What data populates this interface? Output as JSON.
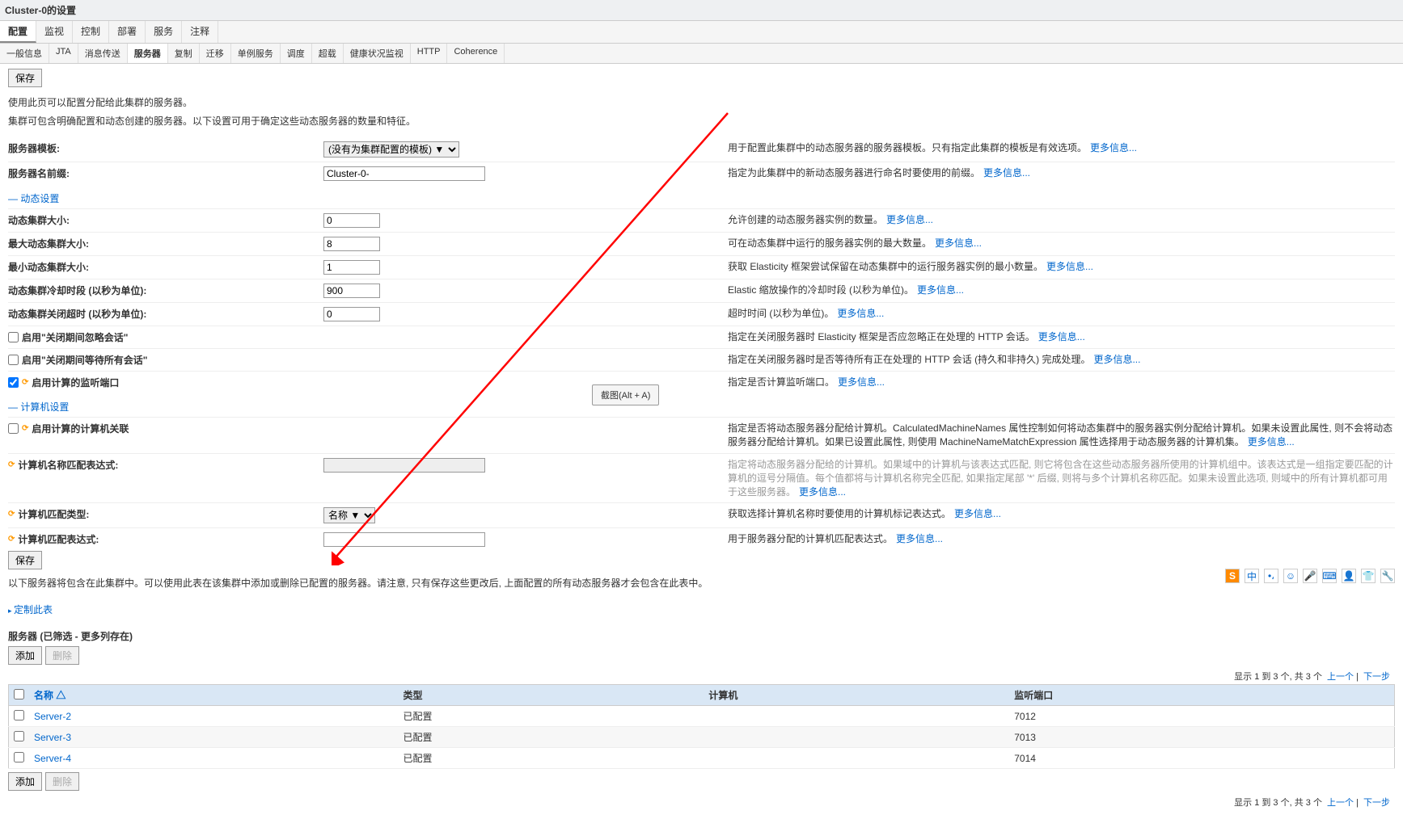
{
  "page_title": "Cluster-0的设置",
  "main_tabs": [
    "配置",
    "监视",
    "控制",
    "部署",
    "服务",
    "注释"
  ],
  "main_tab_active": 0,
  "sub_tabs": [
    "一般信息",
    "JTA",
    "消息传送",
    "服务器",
    "复制",
    "迁移",
    "单例服务",
    "调度",
    "超载",
    "健康状况监视",
    "HTTP",
    "Coherence"
  ],
  "sub_tab_active": 3,
  "save_button": "保存",
  "intro_lines": [
    "使用此页可以配置分配给此集群的服务器。",
    "集群可包含明确配置和动态创建的服务器。以下设置可用于确定这些动态服务器的数量和特征。"
  ],
  "form": {
    "server_template": {
      "label": "服务器模板:",
      "value": "(没有为集群配置的模板) ▼",
      "desc": "用于配置此集群中的动态服务器的服务器模板。只有指定此集群的模板是有效选项。",
      "more": "更多信息..."
    },
    "server_prefix": {
      "label": "服务器名前缀:",
      "value": "Cluster-0-",
      "desc": "指定为此集群中的新动态服务器进行命名时要使用的前缀。",
      "more": "更多信息..."
    }
  },
  "dyn_legend": "动态设置",
  "dyn": {
    "size": {
      "label": "动态集群大小:",
      "value": "0",
      "desc": "允许创建的动态服务器实例的数量。",
      "more": "更多信息..."
    },
    "max": {
      "label": "最大动态集群大小:",
      "value": "8",
      "desc": "可在动态集群中运行的服务器实例的最大数量。",
      "more": "更多信息..."
    },
    "min": {
      "label": "最小动态集群大小:",
      "value": "1",
      "desc": "获取 Elasticity 框架尝试保留在动态集群中的运行服务器实例的最小数量。",
      "more": "更多信息..."
    },
    "cooldown": {
      "label": "动态集群冷却时段 (以秒为单位):",
      "value": "900",
      "desc": "Elastic 缩放操作的冷却时段 (以秒为单位)。",
      "more": "更多信息..."
    },
    "timeout": {
      "label": "动态集群关闭超时 (以秒为单位):",
      "value": "0",
      "desc": "超时时间 (以秒为单位)。",
      "more": "更多信息..."
    },
    "ignore": {
      "label": "启用\"关闭期间忽略会话\"",
      "desc": "指定在关闭服务器时 Elasticity 框架是否应忽略正在处理的 HTTP 会话。",
      "more": "更多信息..."
    },
    "wait_all": {
      "label": "启用\"关闭期间等待所有会话\"",
      "desc": "指定在关闭服务器时是否等待所有正在处理的 HTTP 会话 (持久和非持久) 完成处理。",
      "more": "更多信息..."
    },
    "listen_port": {
      "label": "启用计算的监听端口",
      "desc": "指定是否计算监听端口。",
      "more": "更多信息..."
    }
  },
  "comp_legend": "计算机设置",
  "comp": {
    "assoc": {
      "label": "启用计算的计算机关联",
      "desc": "指定是否将动态服务器分配给计算机。CalculatedMachineNames 属性控制如何将动态集群中的服务器实例分配给计算机。如果未设置此属性, 则不会将动态服务器分配给计算机。如果已设置此属性, 则使用 MachineNameMatchExpression 属性选择用于动态服务器的计算机集。",
      "more": "更多信息..."
    },
    "name_expr": {
      "label": "计算机名称匹配表达式:",
      "desc": "指定将动态服务器分配给的计算机。如果域中的计算机与该表达式匹配, 则它将包含在这些动态服务器所使用的计算机组中。该表达式是一组指定要匹配的计算机的逗号分隔值。每个值都将与计算机名称完全匹配, 如果指定尾部 '*' 后缀, 则将与多个计算机名称匹配。如果未设置此选项, 则域中的所有计算机都可用于这些服务器。",
      "more": "更多信息..."
    },
    "match_type": {
      "label": "计算机匹配类型:",
      "value": "名称 ▼",
      "desc": "获取选择计算机名称时要使用的计算机标记表达式。",
      "more": "更多信息..."
    },
    "match_expr": {
      "label": "计算机匹配表达式:",
      "desc": "用于服务器分配的计算机匹配表达式。",
      "more": "更多信息..."
    }
  },
  "note": "以下服务器将包含在此集群中。可以使用此表在该集群中添加或删除已配置的服务器。请注意, 只有保存这些更改后, 上面配置的所有动态服务器才会包含在此表中。",
  "customize_link": "定制此表",
  "table_title": "服务器 (已筛选 - 更多列存在)",
  "add_btn": "添加",
  "del_btn": "删除",
  "pager": {
    "text": "显示 1 到 3 个, 共 3 个",
    "prev": "上一个",
    "next": "下一步"
  },
  "columns": [
    "名称",
    "类型",
    "计算机",
    "监听端口"
  ],
  "sort_indicator": " △",
  "rows": [
    {
      "name": "Server-2",
      "type": "已配置",
      "machine": "",
      "port": "7012"
    },
    {
      "name": "Server-3",
      "type": "已配置",
      "machine": "",
      "port": "7013"
    },
    {
      "name": "Server-4",
      "type": "已配置",
      "machine": "",
      "port": "7014"
    }
  ],
  "tooltip": "截图(Alt + A)",
  "ime": {
    "s": "S",
    "zhong": "中"
  }
}
